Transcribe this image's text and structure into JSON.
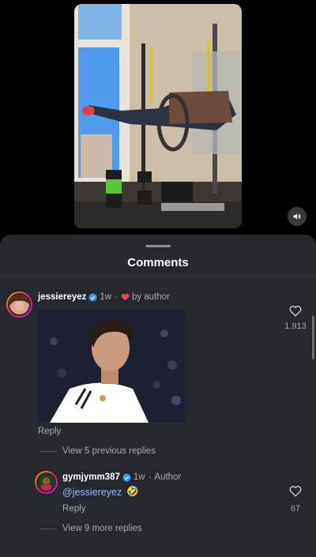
{
  "sheet": {
    "title": "Comments"
  },
  "comments": [
    {
      "username": "jessiereyez",
      "time": "1w",
      "author_note": "by author",
      "reply_label": "Reply",
      "likes": "1.913",
      "view_replies": "View 5 previous replies"
    }
  ],
  "reply": {
    "username": "gymjymm387",
    "time": "1w",
    "author_tag": "Author",
    "mention": "@jessiereyez",
    "emoji": "🤣",
    "reply_label": "Reply",
    "likes": "67",
    "view_replies": "View 9 more replies"
  },
  "colors": {
    "sheet_bg": "#25292e",
    "verified": "#3897f0",
    "heart": "#ed4956",
    "mention": "#9fb4ff"
  },
  "icons": [
    "speaker-icon",
    "verified-icon",
    "heart-icon",
    "heart-outline-icon"
  ]
}
